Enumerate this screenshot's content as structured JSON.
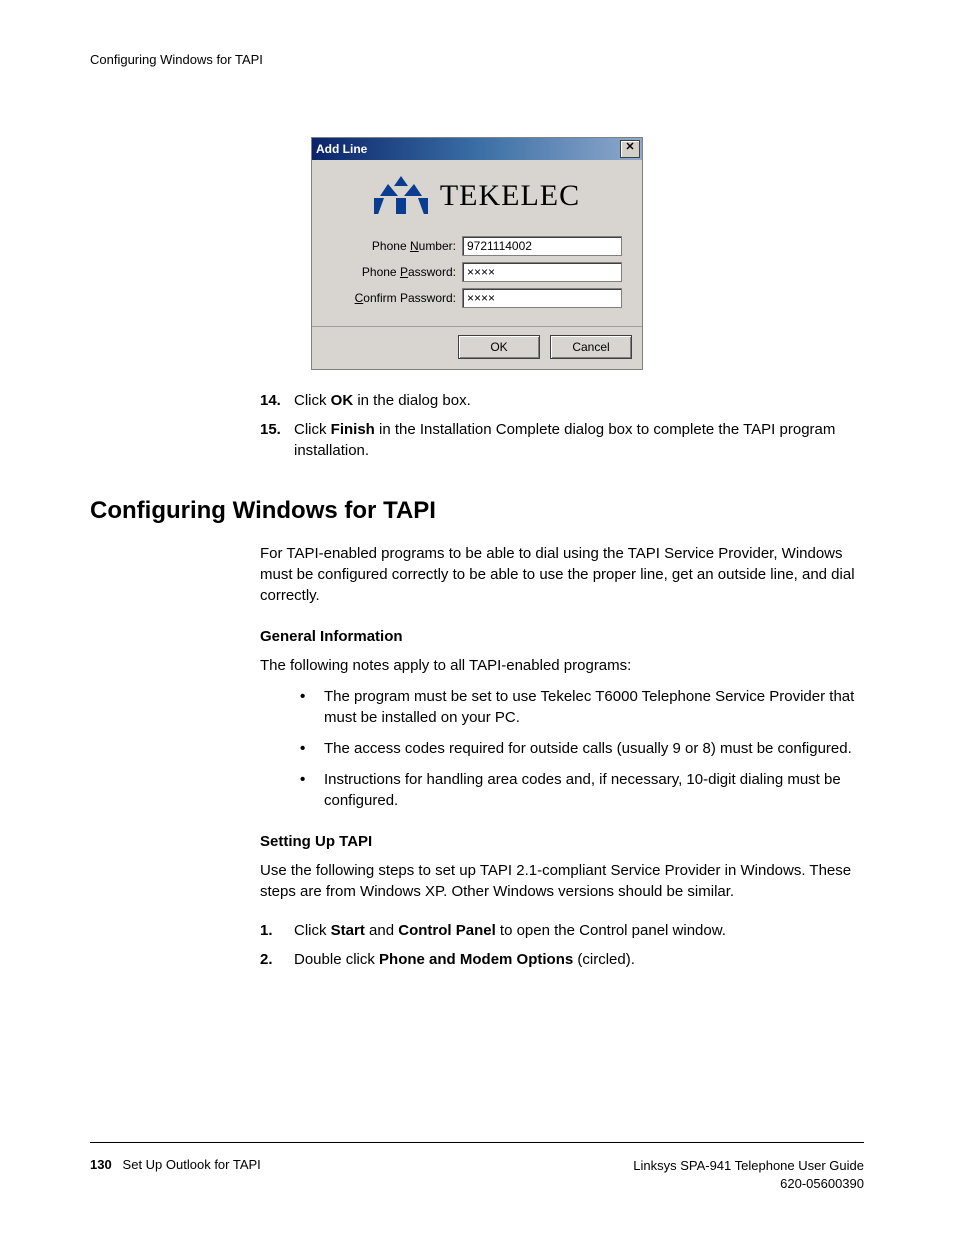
{
  "running_header": "Configuring Windows for TAPI",
  "dialog": {
    "title": "Add Line",
    "logo_text": "TEKELEC",
    "phone_number_label_pre": "Phone ",
    "phone_number_label_u": "N",
    "phone_number_label_post": "umber:",
    "phone_number_value": "9721114002",
    "phone_password_label_pre": "Phone ",
    "phone_password_label_u": "P",
    "phone_password_label_post": "assword:",
    "phone_password_value": "××××",
    "confirm_password_label_u": "C",
    "confirm_password_label_post": "onfirm Password:",
    "confirm_password_value": "××××",
    "ok": "OK",
    "cancel": "Cancel"
  },
  "steps_top": [
    {
      "num": "14.",
      "html": "Click <b>OK</b> in the dialog box."
    },
    {
      "num": "15.",
      "html": "Click <b>Finish</b> in the Installation Complete dialog box to complete the TAPI program installation."
    }
  ],
  "section_heading": "Configuring Windows for TAPI",
  "section_intro": "For TAPI-enabled programs to be able to dial using the TAPI Service Provider, Windows must be configured correctly to be able to use the proper line, get an outside line, and dial correctly.",
  "general_heading": "General Information",
  "general_intro": "The following notes apply to all TAPI-enabled programs:",
  "general_bullets": [
    "The program must be set to use Tekelec T6000 Telephone Service Provider that must be installed on your PC.",
    "The access codes required for outside calls (usually 9 or 8) must be configured.",
    "Instructions for handling area codes and, if necessary, 10-digit dialing must be configured."
  ],
  "setup_heading": "Setting Up TAPI",
  "setup_intro": "Use the following steps to set up TAPI 2.1-compliant Service Provider in Windows. These steps are from Windows XP. Other Windows versions should be similar.",
  "setup_steps": [
    {
      "num": "1.",
      "html": "Click <b>Start</b> and <b>Control Panel</b> to open the Control panel window."
    },
    {
      "num": "2.",
      "html": "Double click <b>Phone and Modem Options</b> (circled)."
    }
  ],
  "footer": {
    "page_num": "130",
    "chapter": "Set Up Outlook for TAPI",
    "guide": "Linksys SPA-941 Telephone User Guide",
    "docnum": "620-05600390"
  }
}
